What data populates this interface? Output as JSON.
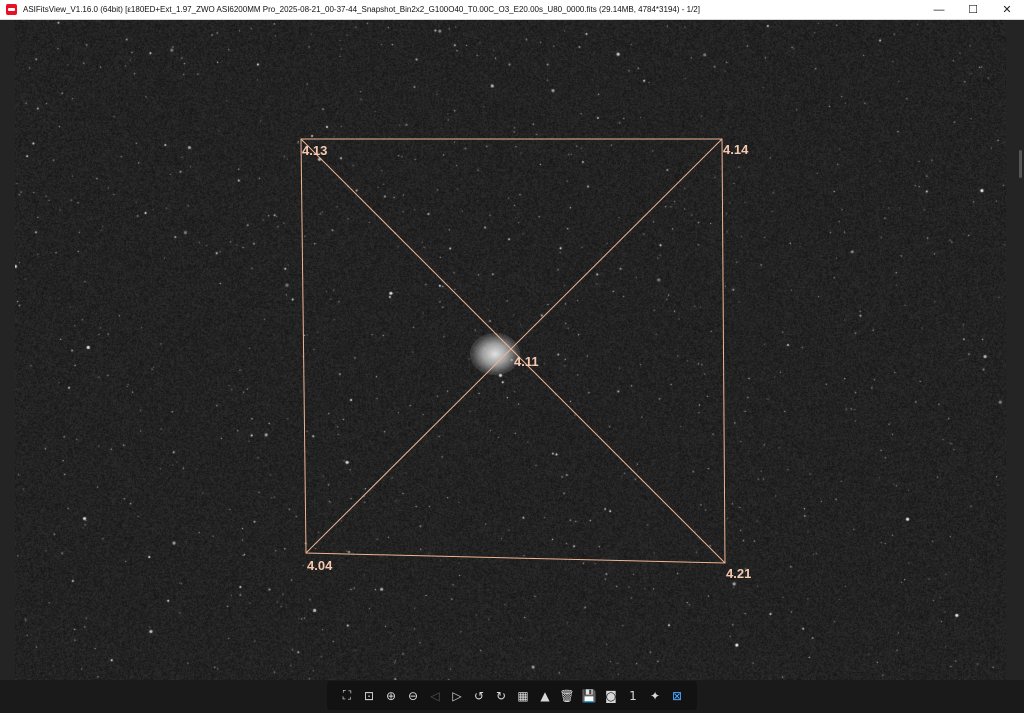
{
  "window": {
    "title": "ASIFitsView_V1.16.0 (64bit) [ε180ED+Ext_1.97_ZWO ASI6200MM Pro_2025-08-21_00-37-44_Snapshot_Bin2x2_G100O40_T0.00C_O3_E20.00s_U80_0000.fits (29.14MB, 4784*3194) - 1/2]",
    "minimize_label": "—",
    "maximize_label": "☐",
    "close_label": "✕"
  },
  "image": {
    "tilt_labels": {
      "top_left": "4.13",
      "top_right": "4.14",
      "center": "4.11",
      "bottom_left": "4.04",
      "bottom_right": "4.21"
    },
    "overlay_color": "#f0b495",
    "label_color": "#f4c9b0"
  },
  "toolbar": {
    "buttons": [
      {
        "name": "fit-to-window-icon",
        "glyph": "⛶",
        "state": "normal"
      },
      {
        "name": "actual-size-icon",
        "glyph": "⊡",
        "state": "normal"
      },
      {
        "name": "zoom-in-icon",
        "glyph": "⊕",
        "state": "normal"
      },
      {
        "name": "zoom-out-icon",
        "glyph": "⊖",
        "state": "normal"
      },
      {
        "name": "previous-icon",
        "glyph": "◁",
        "state": "disabled"
      },
      {
        "name": "next-icon",
        "glyph": "▷",
        "state": "normal"
      },
      {
        "name": "rotate-left-icon",
        "glyph": "↺",
        "state": "normal"
      },
      {
        "name": "rotate-right-icon",
        "glyph": "↻",
        "state": "normal"
      },
      {
        "name": "debayer-icon",
        "glyph": "▦",
        "state": "normal"
      },
      {
        "name": "histogram-icon",
        "glyph": "▲",
        "state": "normal"
      },
      {
        "name": "delete-icon",
        "glyph": "🗑",
        "state": "normal"
      },
      {
        "name": "save-icon",
        "glyph": "💾",
        "state": "normal"
      },
      {
        "name": "info-icon",
        "glyph": "◙",
        "state": "normal"
      },
      {
        "name": "one-to-one-icon",
        "glyph": "1",
        "state": "normal"
      },
      {
        "name": "star-detect-icon",
        "glyph": "✦",
        "state": "normal"
      },
      {
        "name": "tilt-analysis-icon",
        "glyph": "⊠",
        "state": "active"
      }
    ]
  }
}
